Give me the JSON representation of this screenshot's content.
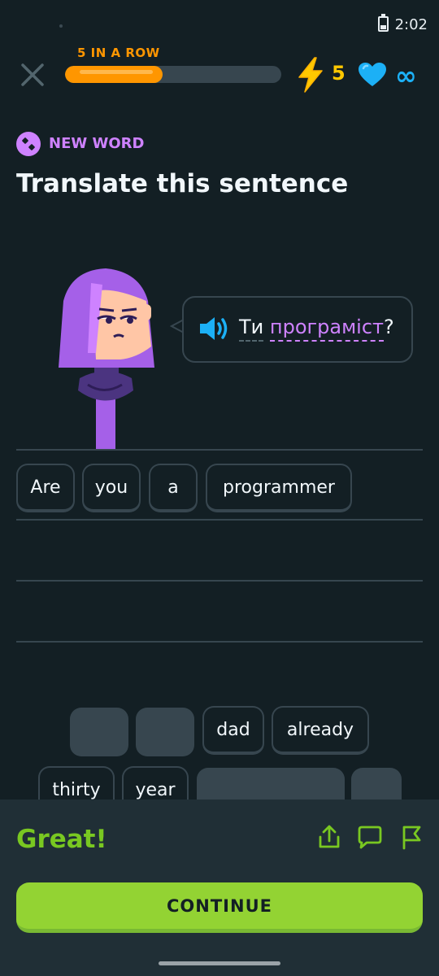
{
  "status": {
    "time": "2:02"
  },
  "header": {
    "streak_label": "5 IN A ROW",
    "progress_fraction": 0.45,
    "bolt_count": "5",
    "lives": "∞"
  },
  "badge": {
    "label": "NEW WORD"
  },
  "title": "Translate this sentence",
  "prompt": {
    "word1": "Ти",
    "word2": "програміст",
    "punct": "?"
  },
  "answer_chips": [
    "Are",
    "you",
    "a",
    "programmer"
  ],
  "bank": {
    "row1": [
      "",
      "",
      "dad",
      "already"
    ],
    "row2": [
      "thirty",
      "year",
      "",
      ""
    ]
  },
  "feedback": {
    "message": "Great!",
    "continue_label": "CONTINUE"
  },
  "colors": {
    "background": "#131f24",
    "accent_orange": "#ff9600",
    "accent_purple": "#ce82ff",
    "accent_green": "#93d333",
    "accent_blue": "#1cb0f6",
    "success_text": "#79c821"
  }
}
